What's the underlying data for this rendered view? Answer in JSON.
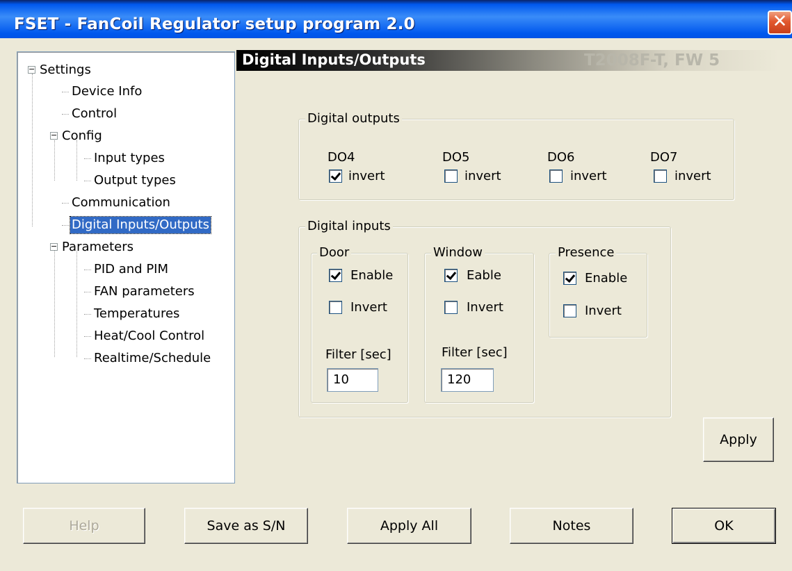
{
  "window": {
    "title": "FSET - FanCoil Regulator setup program 2.0",
    "close_glyph": "✕"
  },
  "tree": {
    "root": "Settings",
    "items": {
      "device_info": "Device Info",
      "control": "Control",
      "config": "Config",
      "input_types": "Input types",
      "output_types": "Output types",
      "communication": "Communication",
      "digital_io": "Digital Inputs/Outputs",
      "parameters": "Parameters",
      "pid_pim": "PID and PIM",
      "fan_parameters": "FAN parameters",
      "temperatures": "Temperatures",
      "heat_cool": "Heat/Cool Control",
      "realtime": "Realtime/Schedule"
    },
    "expander_glyph": "−",
    "selected": "Digital Inputs/Outputs"
  },
  "panel": {
    "title": "Digital Inputs/Outputs",
    "device": "T2008F-T, FW 5"
  },
  "digital_outputs": {
    "legend": "Digital outputs",
    "outputs": [
      {
        "name": "DO4",
        "invert_label": "invert",
        "invert": true
      },
      {
        "name": "DO5",
        "invert_label": "invert",
        "invert": false
      },
      {
        "name": "DO6",
        "invert_label": "invert",
        "invert": false
      },
      {
        "name": "DO7",
        "invert_label": "invert",
        "invert": false
      }
    ]
  },
  "digital_inputs": {
    "legend": "Digital inputs",
    "door": {
      "legend": "Door",
      "enable_label": "Enable",
      "enable": true,
      "invert_label": "Invert",
      "invert": false,
      "filter_label": "Filter [sec]",
      "filter_value": "10"
    },
    "window": {
      "legend": "Window",
      "enable_label": "Eable",
      "enable": true,
      "invert_label": "Invert",
      "invert": false,
      "filter_label": "Filter [sec]",
      "filter_value": "120"
    },
    "presence": {
      "legend": "Presence",
      "enable_label": "Enable",
      "enable": true,
      "invert_label": "Invert",
      "invert": false
    }
  },
  "buttons": {
    "apply": "Apply",
    "help": "Help",
    "save_sn": "Save as S/N",
    "apply_all": "Apply All",
    "notes": "Notes",
    "ok": "OK"
  },
  "colors": {
    "titlebar": "#0058EE",
    "selection": "#316AC5",
    "close": "#E2582E",
    "face": "#ECE9D8"
  }
}
